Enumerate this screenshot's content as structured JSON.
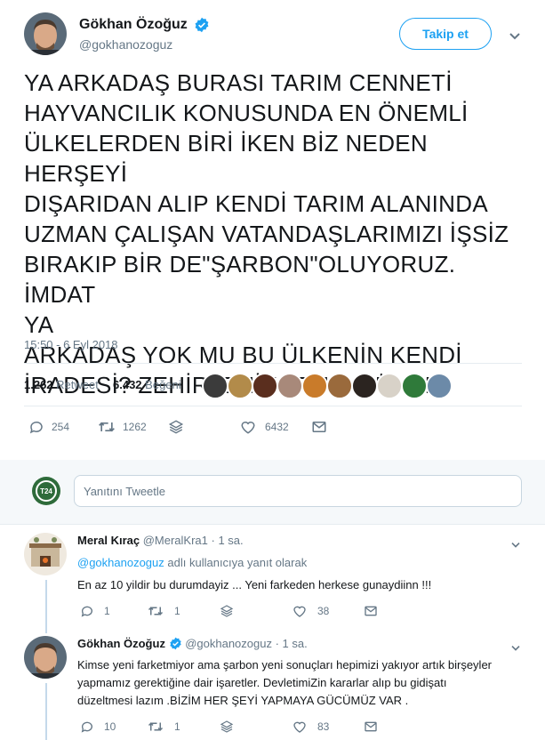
{
  "author": {
    "name": "Gökhan Özoğuz",
    "handle": "@gokhanozoguz",
    "follow_label": "Takip et"
  },
  "tweet": {
    "text": "YA ARKADAŞ BURASI TARIM CENNETİ\nHAYVANCILIK KONUSUNDA EN ÖNEMLİ\nÜLKELERDEN BİRİ İKEN BİZ NEDEN HERŞEYİ\nDIŞARIDAN ALIP KENDİ TARIM ALANINDA\nUZMAN ÇALIŞAN VATANDAŞLARIMIZI İŞSİZ\nBIRAKIP BİR DE\"ŞARBON\"OLUYORUZ. İMDAT\nYA\nARKADAŞ YOK MU BU ÜLKENİN KENDİ\nİRADESİ? ZEHİRLENİYORUZ. GÜNAH!",
    "timestamp": "15:50 - 6 Eyl 2018",
    "retweet_count": "1.262",
    "retweet_label": "Retweet",
    "like_count": "6.432",
    "like_label": "Beğeni",
    "actions": {
      "replies": "254",
      "retweets": "1262",
      "likes": "6432"
    }
  },
  "reply_composer": {
    "placeholder": "Yanıtını Tweetle",
    "avatar_text": "T24"
  },
  "replies": [
    {
      "name": "Meral Kıraç",
      "handle": "@MeralKra1",
      "time": "· 1 sa.",
      "reply_to_handle": "@gokhanozoguz",
      "reply_to_suffix": "adlı kullanıcıya yanıt olarak",
      "text": "En az 10 yildir bu durumdayiz ... Yeni farkeden  herkese gunaydiinn !!!",
      "actions": {
        "replies": "1",
        "retweets": "1",
        "likes": "38"
      }
    },
    {
      "name": "Gökhan Özoğuz",
      "handle": "@gokhanozoguz",
      "time": "· 1 sa.",
      "text": "Kimse yeni farketmiyor ama şarbon yeni sonuçları hepimizi yakıyor artık birşeyler\nyapmamız gerektiğine dair işaretler. DevletimiZin kararlar alıp bu gidişatı\ndüzeltmesi lazım .BİZİM HER ŞEYİ YAPMAYA GÜCÜMÜZ VAR .",
      "actions": {
        "replies": "10",
        "retweets": "1",
        "likes": "83"
      }
    }
  ],
  "colors": {
    "accent": "#1da1f2",
    "text": "#14171a",
    "muted": "#657786",
    "divider": "#e6ecf0"
  }
}
